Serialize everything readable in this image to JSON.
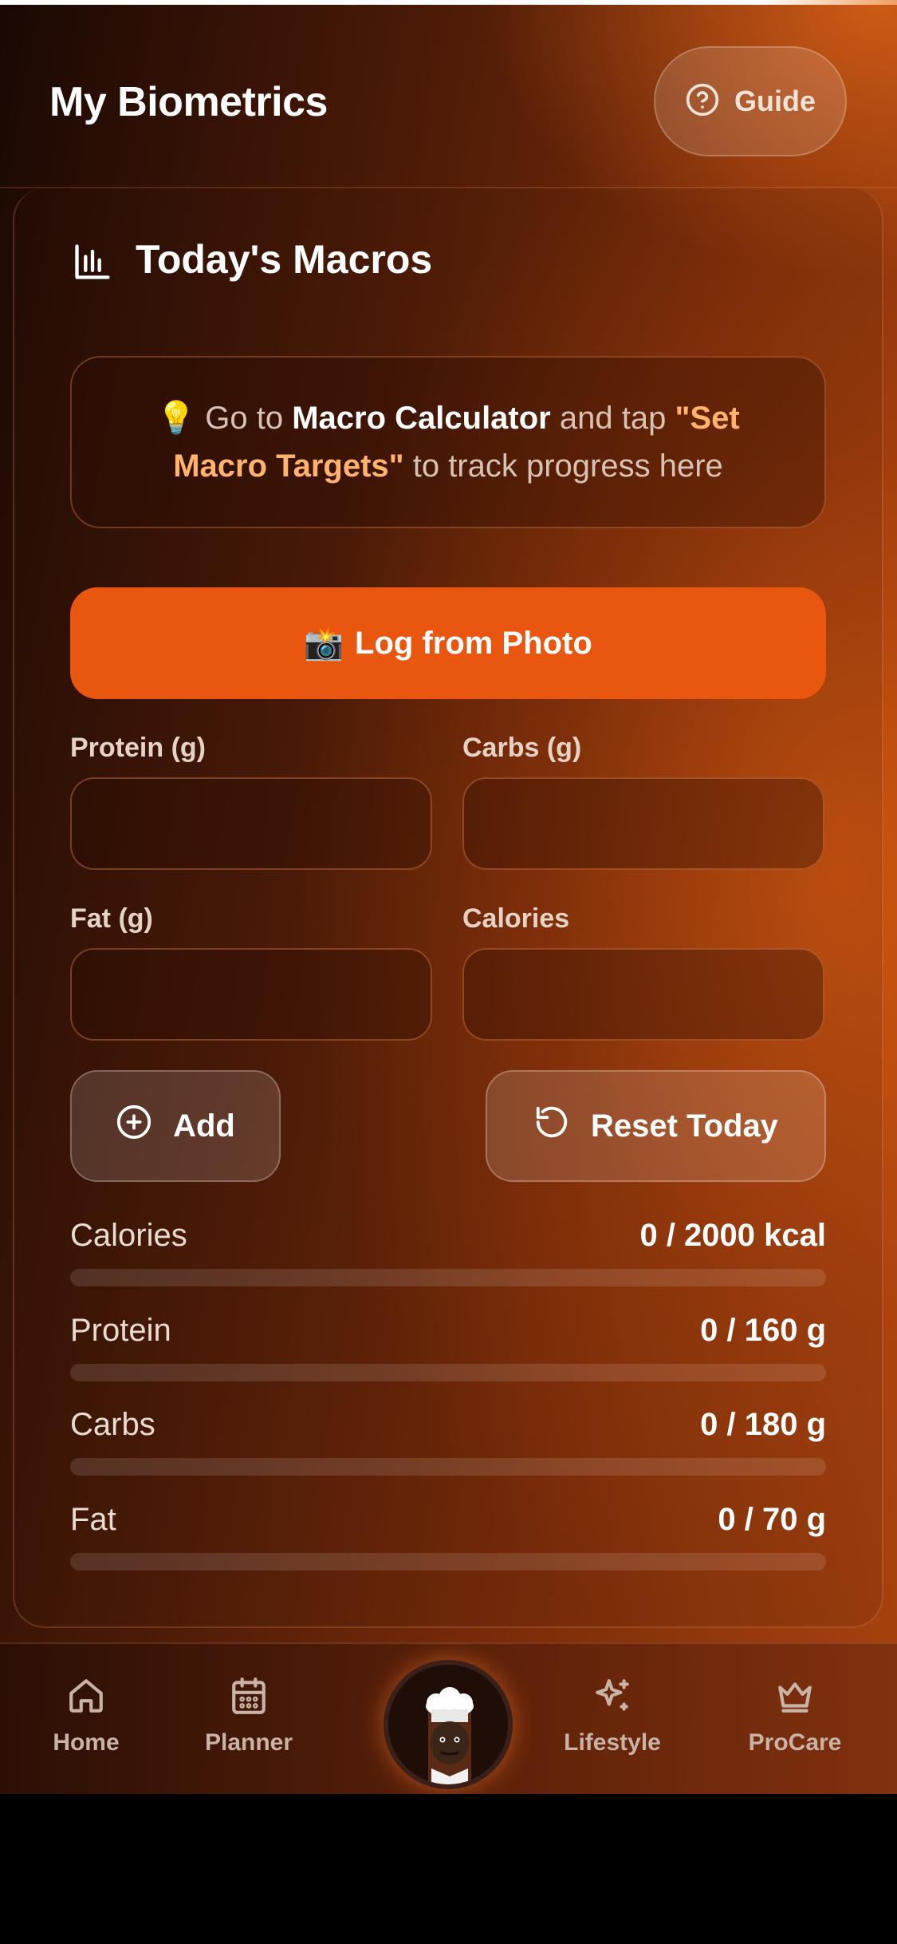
{
  "header": {
    "title": "My Biometrics",
    "guide_label": "Guide"
  },
  "card": {
    "title": "Today's Macros",
    "tip": {
      "emoji": "💡",
      "part1": "Go to ",
      "part2": "Macro Calculator",
      "part3": " and tap ",
      "part4": "\"Set Macro Targets\"",
      "part5": " to track progress here"
    },
    "log_photo_emoji": "📸",
    "log_photo_label": "Log from Photo",
    "fields": {
      "protein_label": "Protein (g)",
      "carbs_label": "Carbs (g)",
      "fat_label": "Fat (g)",
      "calories_label": "Calories",
      "protein_value": "",
      "carbs_value": "",
      "fat_value": "",
      "calories_value": ""
    },
    "add_label": "Add",
    "reset_label": "Reset Today",
    "stats": [
      {
        "label": "Calories",
        "value": "0 / 2000 kcal",
        "progress": 0
      },
      {
        "label": "Protein",
        "value": "0 / 160 g",
        "progress": 0
      },
      {
        "label": "Carbs",
        "value": "0 / 180 g",
        "progress": 0
      },
      {
        "label": "Fat",
        "value": "0 / 70 g",
        "progress": 0
      }
    ]
  },
  "nav": {
    "items": [
      {
        "label": "Home",
        "icon": "home-icon"
      },
      {
        "label": "Planner",
        "icon": "calendar-icon"
      },
      {
        "label": "Lifestyle",
        "icon": "sparkles-icon"
      },
      {
        "label": "ProCare",
        "icon": "crown-icon"
      }
    ],
    "center_icon": "chef-avatar"
  },
  "colors": {
    "accent": "#e8560f",
    "highlight": "#ffb36b",
    "background_dark": "#1a0804",
    "background_warm": "#a4410f"
  }
}
